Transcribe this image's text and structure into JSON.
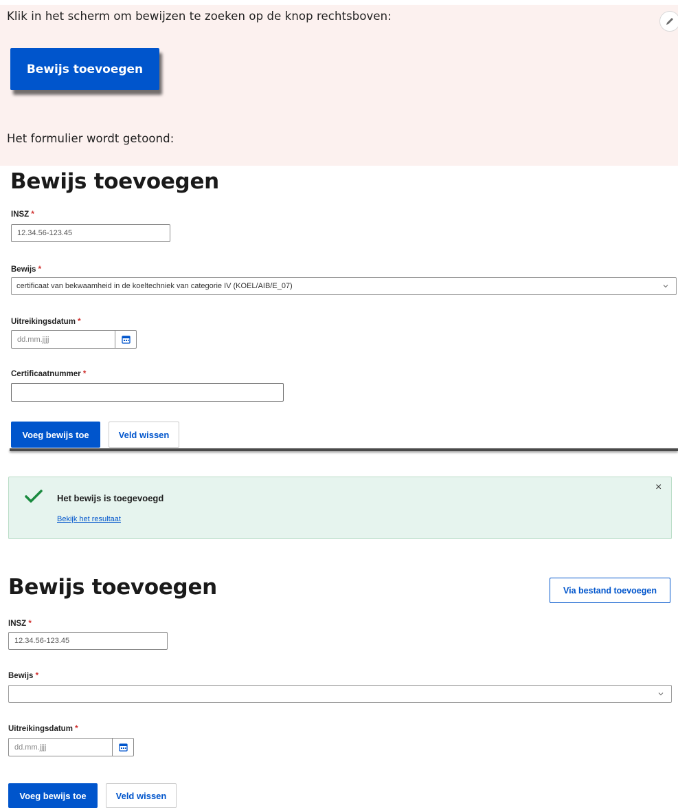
{
  "instructions": {
    "line1": "Klik in het scherm om bewijzen te zoeken op de knop rechtsboven:",
    "demo_button": "Bewijs toevoegen",
    "line2": "Het formulier wordt getoond:"
  },
  "form1": {
    "title": "Bewijs toevoegen",
    "insz_label": "INSZ",
    "insz_value": "12.34.56-123.45",
    "bewijs_label": "Bewijs",
    "bewijs_value": "certificaat van bekwaamheid in de koeltechniek van categorie IV (KOEL/AIB/E_07)",
    "date_label": "Uitreikingsdatum",
    "date_placeholder": "dd.mm.jjjj",
    "cert_label": "Certificaatnummer",
    "cert_value": "",
    "submit": "Voeg bewijs toe",
    "clear": "Veld wissen"
  },
  "alert": {
    "title": "Het bewijs is toegevoegd",
    "link": "Bekijk het resultaat",
    "close": "×"
  },
  "form2": {
    "title": "Bewijs toevoegen",
    "file_button": "Via bestand toevoegen",
    "insz_label": "INSZ",
    "insz_value": "12.34.56-123.45",
    "bewijs_label": "Bewijs",
    "bewijs_value": "",
    "date_label": "Uitreikingsdatum",
    "date_placeholder": "dd.mm.jjjj",
    "submit": "Voeg bewijs toe",
    "clear": "Veld wissen"
  },
  "required_marker": "*",
  "colors": {
    "primary": "#0055cc",
    "instruction_bg": "#fcf1ef",
    "success_bg": "#e6f4ee",
    "success_check": "#1a8a3f",
    "required": "#d0302e"
  }
}
